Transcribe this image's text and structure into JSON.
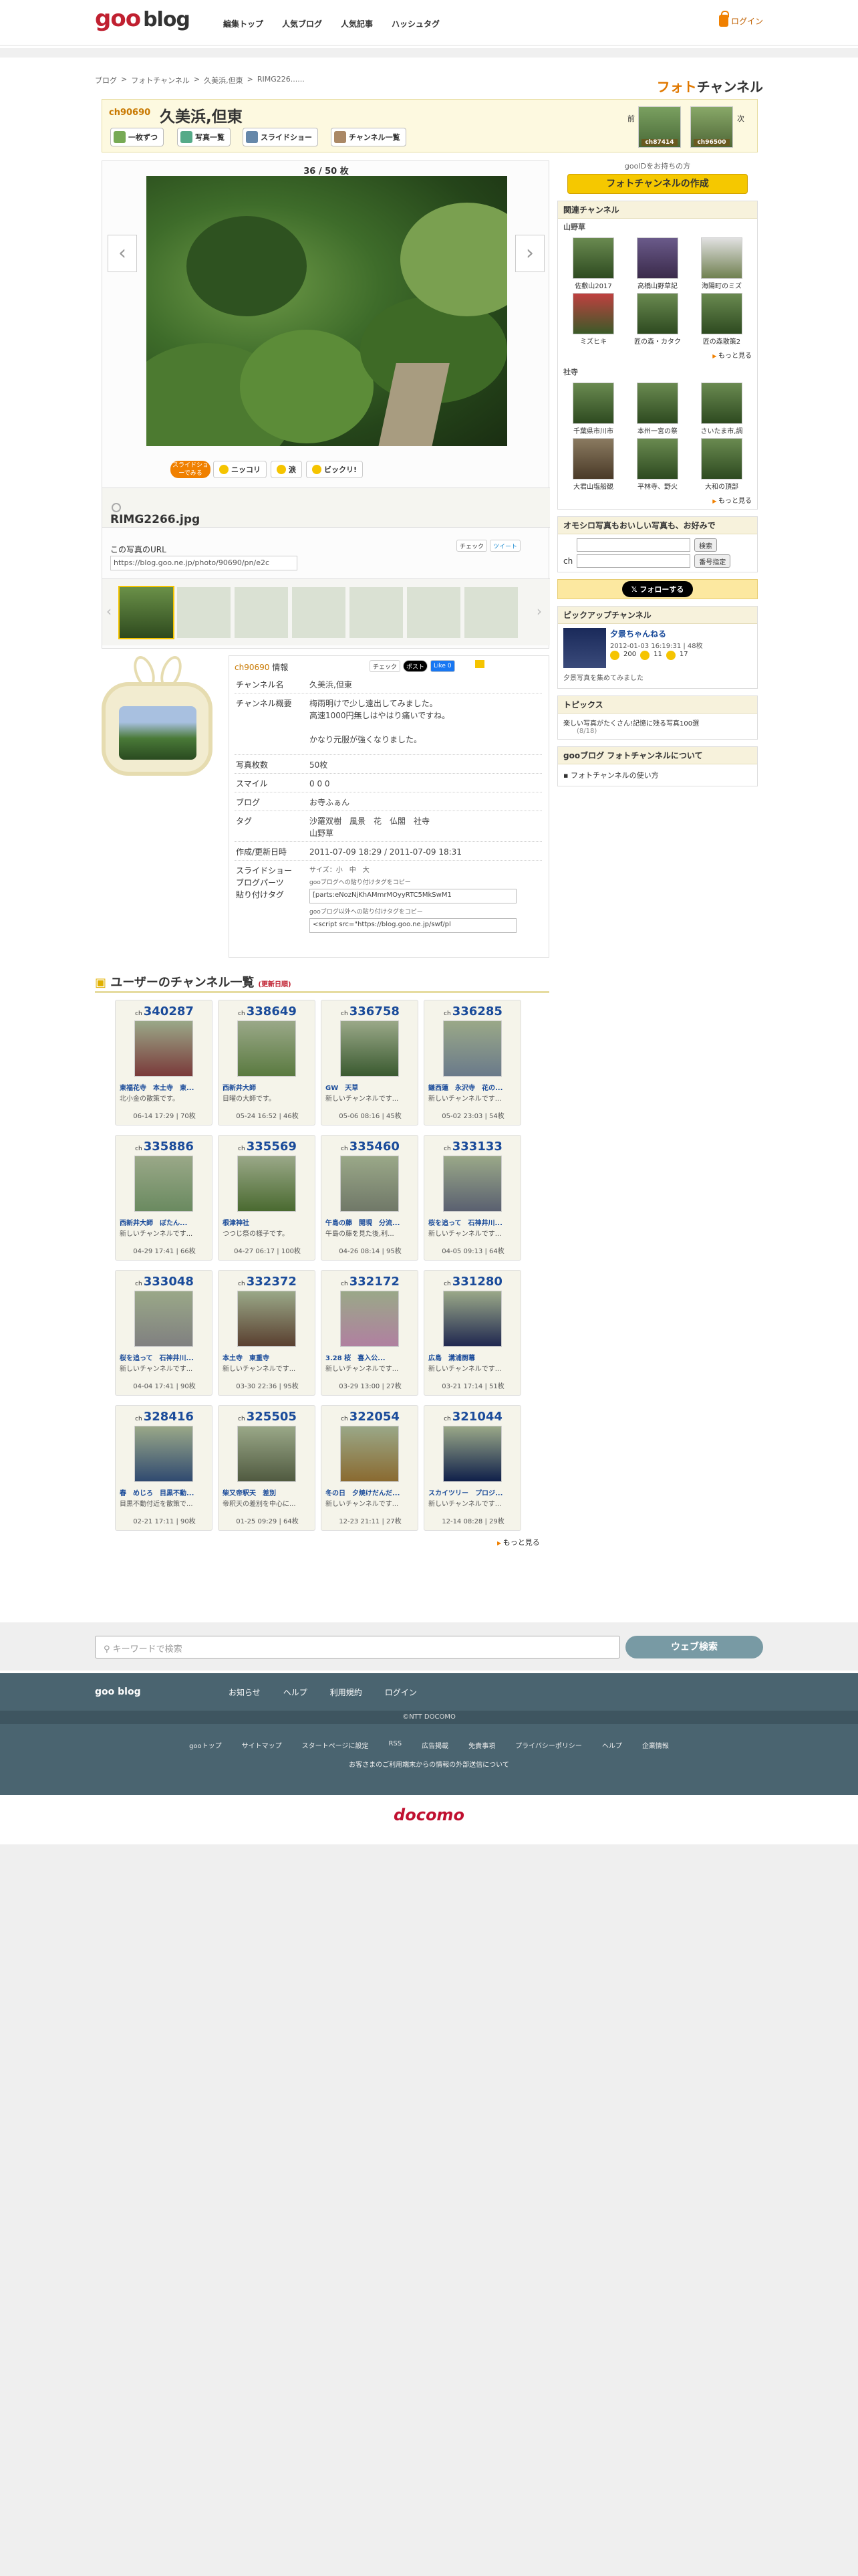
{
  "header": {
    "logo_goo": "goo",
    "logo_blog": "blog",
    "nav": [
      "編集トップ",
      "人気ブログ",
      "人気記事",
      "ハッシュタグ"
    ],
    "login": "ログイン"
  },
  "breadcrumb": [
    "ブログ",
    "フォトチャンネル",
    "久美浜,但東",
    "RIMG226......"
  ],
  "brand": {
    "prefix": "フォト",
    "suffix": "チャンネル"
  },
  "channel": {
    "number": "ch90690",
    "title": "久美浜,但東",
    "buttons": [
      "一枚ずつ",
      "写真一覧",
      "スライドショー",
      "チャンネル一覧"
    ],
    "prev_label": "前",
    "next_label": "次",
    "prev_ch": "ch87414",
    "next_ch": "ch96500"
  },
  "viewer": {
    "counter": "36 / 50 枚",
    "slideshow_tag": "スライドショーでみる",
    "reactions": [
      "ニッコリ",
      "涙",
      "ビックリ!"
    ],
    "filename": "RIMG2266.jpg",
    "url_label": "この写真のURL",
    "url_value": "https://blog.goo.ne.jp/photo/90690/pn/e2c",
    "share": [
      "チェック",
      "ツイート"
    ]
  },
  "right": {
    "goo_id_note": "gooIDをお持ちの方",
    "create_btn": "フォトチャンネルの作成",
    "related_title": "関連チャンネル",
    "group1_title": "山野草",
    "group1": [
      "社寺",
      "高橋山野草記",
      "海陽町のミズ",
      "ミズヒキ",
      "匠の森・カタク",
      "匠の森散策2"
    ],
    "group1_first": "佐敷山2017",
    "group2_title": "社寺",
    "group2": [
      "千葉県市川市",
      "本州一宮の祭",
      "さいたま市,調",
      "大君山塩船観",
      "平林寺、野火",
      "大和の頂部"
    ],
    "more": "もっと見る",
    "search_title": "オモシロ写真もおいしい写真も、お好みで",
    "search_btn": "検索",
    "number_btn": "番号指定",
    "ch_label": "ch",
    "follow": "フォローする",
    "pickup_title": "ピックアップチャンネル",
    "pickup_name": "夕景ちゃんねる",
    "pickup_meta": "2012-01-03 16:19:31 | 48枚",
    "pickup_counts": [
      "200",
      "11",
      "17"
    ],
    "pickup_desc": "夕景写真を集めてみました",
    "topics_title": "トピックス",
    "topics_item": "楽しい写真がたくさん!記憶に残る写真100選",
    "topics_note": "(8/18)",
    "about_title": "gooブログ フォトチャンネルについて",
    "about_link": "フォトチャンネルの使い方"
  },
  "info": {
    "hd_ch": "ch90690",
    "hd_label": "情報",
    "share": [
      "チェック",
      "ポスト",
      "Like 0"
    ],
    "rows": [
      {
        "k": "チャンネル名",
        "v": "久美浜,但東"
      },
      {
        "k": "チャンネル概要",
        "v": "梅雨明けで少し遠出してみました。"
      },
      {
        "k": "",
        "v": "高速1000円無しはやはり痛いですね。"
      },
      {
        "k": "",
        "v": "かなり元服が強くなりました。"
      },
      {
        "k": "写真枚数",
        "v": "50枚"
      },
      {
        "k": "スマイル",
        "v": "0    0    0"
      },
      {
        "k": "ブログ",
        "v": "お寺ふぁん"
      },
      {
        "k": "タグ",
        "v": "沙羅双樹　風景　花　仏閣　社寺"
      },
      {
        "k": "",
        "v": "山野草"
      },
      {
        "k": "作成/更新日時",
        "v": "2011-07-09 18:29 / 2011-07-09 18:31"
      },
      {
        "k": "スライドショー",
        "v": "サイズ：小　中　大"
      },
      {
        "k": "ブログパーツ",
        "v": "gooブログへの貼り付けタグをコピー"
      },
      {
        "k": "貼り付けタグ",
        "v": "[parts:eNozNjKhAMmrMOyyRTC5MkSwM1"
      },
      {
        "k": "",
        "v": "gooブログ以外への貼り付けタグをコピー"
      },
      {
        "k": "",
        "v": "<script src=\"https://blog.goo.ne.jp/swf/pl"
      }
    ]
  },
  "userlist": {
    "title": "ユーザーのチャンネル一覧",
    "badge": "(更新日順)",
    "ch_prefix": "ch",
    "more": "もっと見る",
    "cards": [
      {
        "n": "340287",
        "t": "東福花寺　本土寺　東...",
        "d": "北小金の散策です。",
        "m": "06-14 17:29 | 70枚"
      },
      {
        "n": "338649",
        "t": "西新井大師",
        "d": "目曜の大師です。",
        "m": "05-24 16:52 | 46枚"
      },
      {
        "n": "336758",
        "t": "GW　天草",
        "d": "新しいチャンネルです...",
        "m": "05-06 08:16 | 45枚"
      },
      {
        "n": "336285",
        "t": "鎌西蓮　永沢寺　花の...",
        "d": "新しいチャンネルです...",
        "m": "05-02 23:03 | 54枚"
      },
      {
        "n": "335886",
        "t": "西新井大師　ぼたん...",
        "d": "新しいチャンネルです...",
        "m": "04-29 17:41 | 66枚"
      },
      {
        "n": "335569",
        "t": "根津神社",
        "d": "つつじ祭の様子です。",
        "m": "04-27 06:17 | 100枚"
      },
      {
        "n": "335460",
        "t": "午島の藤　開現　分流...",
        "d": "午島の藤を見た後,利...",
        "m": "04-26 08:14 | 95枚"
      },
      {
        "n": "333133",
        "t": "桜を追って　石神井川...",
        "d": "新しいチャンネルです...",
        "m": "04-05 09:13 | 64枚"
      },
      {
        "n": "333048",
        "t": "桜を追って　石神井川...",
        "d": "新しいチャンネルです...",
        "m": "04-04 17:41 | 90枚"
      },
      {
        "n": "332372",
        "t": "本土寺　東重寺",
        "d": "新しいチャンネルです...",
        "m": "03-30 22:36 | 95枚"
      },
      {
        "n": "332172",
        "t": "3.28 桜　喜入公...",
        "d": "新しいチャンネルです...",
        "m": "03-29 13:00 | 27枚"
      },
      {
        "n": "331280",
        "t": "広島　溝浦厨幕",
        "d": "新しいチャンネルです...",
        "m": "03-21 17:14 | 51枚"
      },
      {
        "n": "328416",
        "t": "春　めじろ　目黒不動...",
        "d": "目黒不動付近を散策で...",
        "m": "02-21 17:11 | 90枚"
      },
      {
        "n": "325505",
        "t": "柴又帝釈天　差別",
        "d": "帝釈天の差別を中心に...",
        "m": "01-25 09:29 | 64枚"
      },
      {
        "n": "322054",
        "t": "冬の日　夕焼けだんだ...",
        "d": "新しいチャンネルです...",
        "m": "12-23 21:11 | 27枚"
      },
      {
        "n": "321044",
        "t": "スカイツリー　プロジ...",
        "d": "新しいチャンネルです...",
        "m": "12-14 08:28 | 29枚"
      }
    ]
  },
  "footer": {
    "search_placeholder": "キーワードで検索",
    "search_btn": "ウェブ検索",
    "brand": "goo blog",
    "nav": [
      "お知らせ",
      "ヘルプ",
      "利用規約",
      "ログイン"
    ],
    "copyright": "©NTT DOCOMO",
    "links": [
      "gooトップ",
      "サイトマップ",
      "スタートページに設定",
      "RSS",
      "広告掲載",
      "免責事項",
      "プライバシーポリシー",
      "ヘルプ",
      "企業情報"
    ],
    "note": "お客さまのご利用端末からの情報の外部送信について",
    "docomo": "docomo"
  }
}
